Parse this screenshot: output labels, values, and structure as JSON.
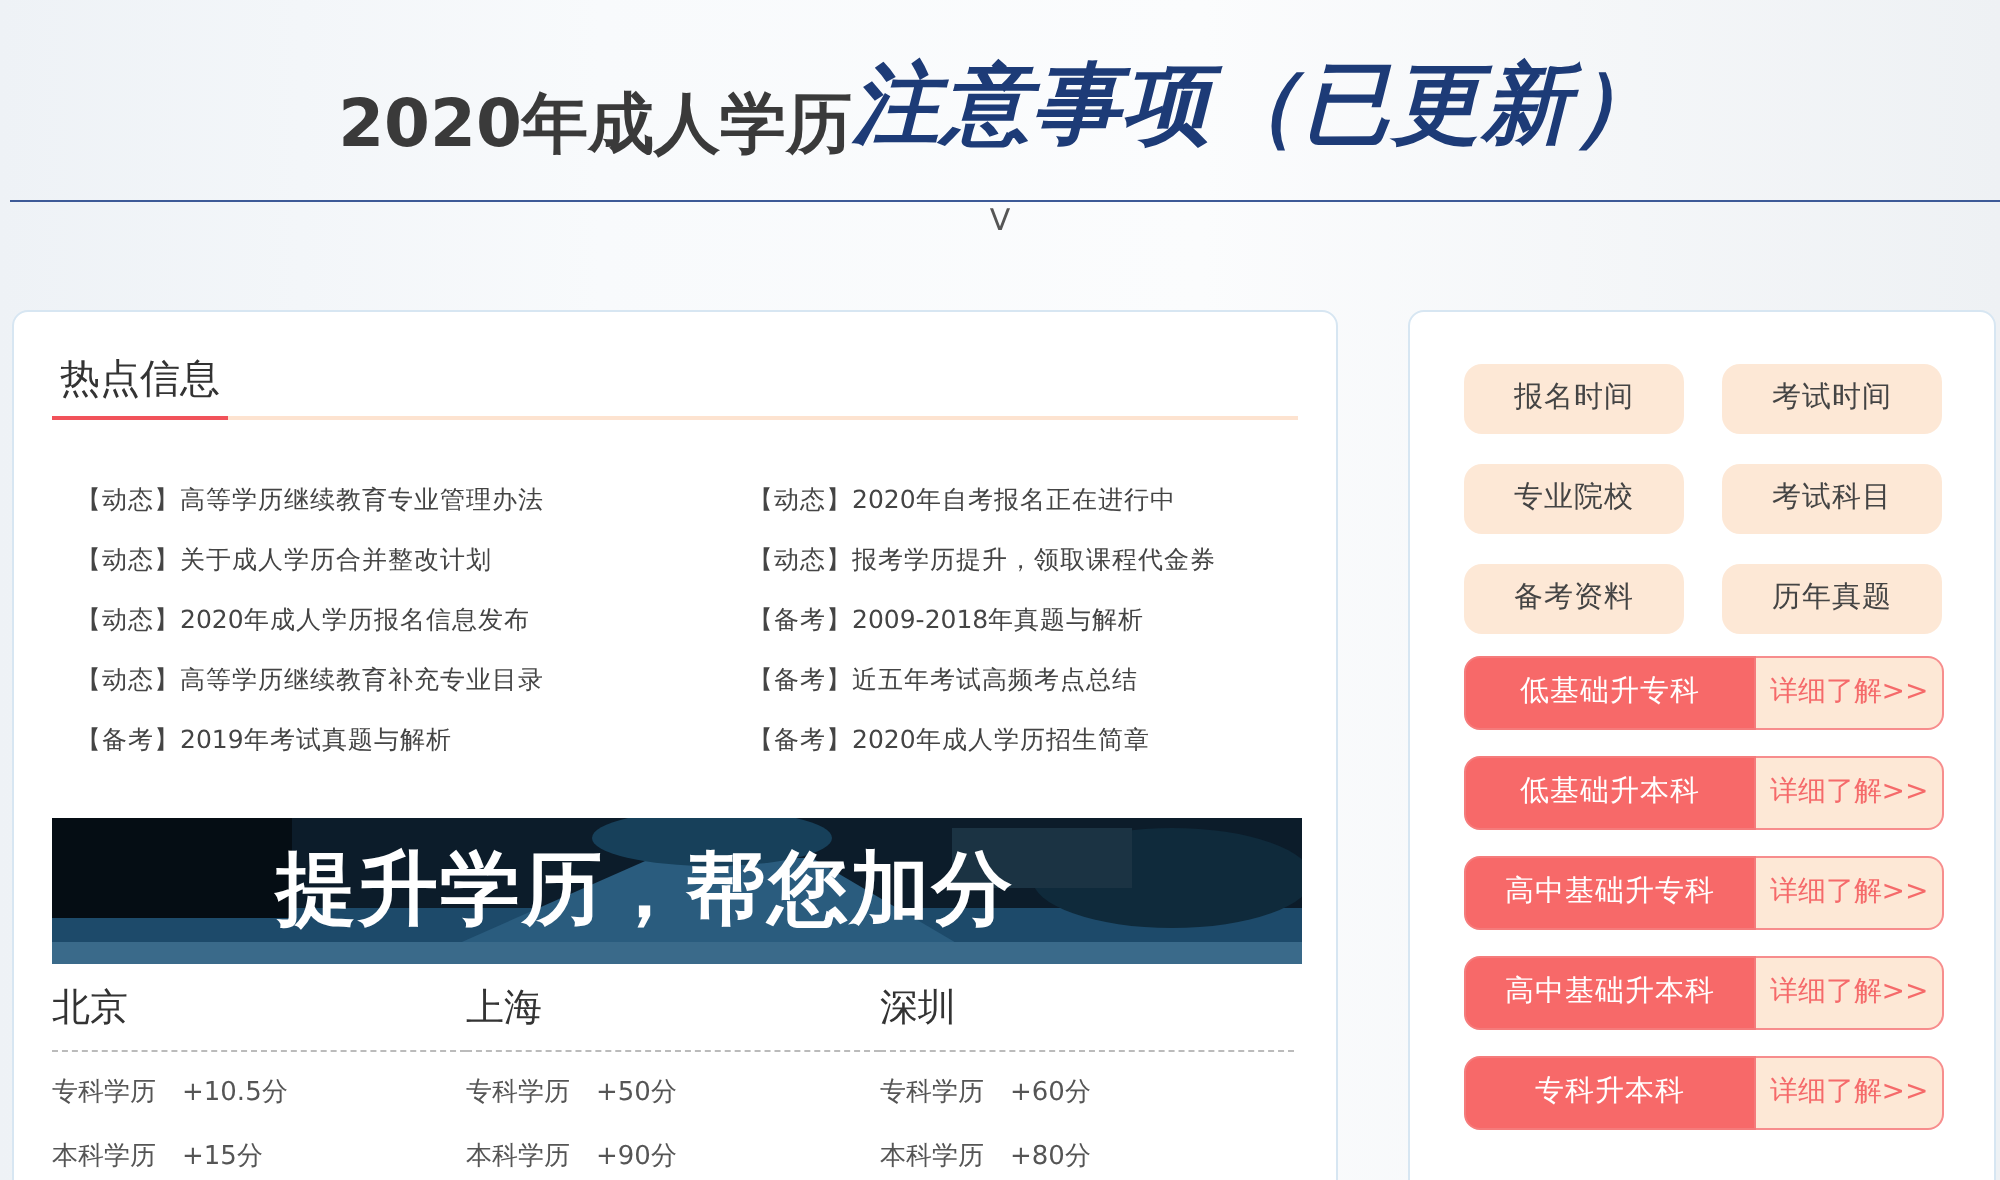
{
  "header": {
    "title_plain": "2020年成人学历",
    "title_emphasis": "注意事项（已更新）",
    "toggle": "V"
  },
  "hot_news": {
    "heading": "热点信息",
    "items": [
      {
        "text": "【动态】高等学历继续教育专业管理办法"
      },
      {
        "text": "【动态】2020年自考报名正在进行中"
      },
      {
        "text": "【动态】关于成人学历合并整改计划"
      },
      {
        "text": "【动态】报考学历提升，领取课程代金券"
      },
      {
        "text": "【动态】2020年成人学历报名信息发布"
      },
      {
        "text": "【备考】2009-2018年真题与解析"
      },
      {
        "text": "【动态】高等学历继续教育补充专业目录"
      },
      {
        "text": "【备考】近五年考试高频考点总结"
      },
      {
        "text": "【备考】2019年考试真题与解析"
      },
      {
        "text": "【备考】2020年成人学历招生简章"
      }
    ]
  },
  "banner": {
    "kind": "picture",
    "headline": "提升学历，帮您加分"
  },
  "cities": [
    {
      "name": "北京",
      "rows": [
        {
          "label": "专科学历",
          "bonus": "+10.5分"
        },
        {
          "label": "本科学历",
          "bonus": "+15分"
        }
      ]
    },
    {
      "name": "上海",
      "rows": [
        {
          "label": "专科学历",
          "bonus": "+50分"
        },
        {
          "label": "本科学历",
          "bonus": "+90分"
        }
      ]
    },
    {
      "name": "深圳",
      "rows": [
        {
          "label": "专科学历",
          "bonus": "+60分"
        },
        {
          "label": "本科学历",
          "bonus": "+80分"
        }
      ]
    }
  ],
  "quick_links": [
    "报名时间",
    "考试时间",
    "专业院校",
    "考试科目",
    "备考资料",
    "历年真题"
  ],
  "programs": [
    {
      "name": "低基础升专科",
      "action": "详细了解>>"
    },
    {
      "name": "低基础升本科",
      "action": "详细了解>>"
    },
    {
      "name": "高中基础升专科",
      "action": "详细了解>>"
    },
    {
      "name": "高中基础升本科",
      "action": "详细了解>>"
    },
    {
      "name": "专科升本科",
      "action": "详细了解>>"
    }
  ]
}
